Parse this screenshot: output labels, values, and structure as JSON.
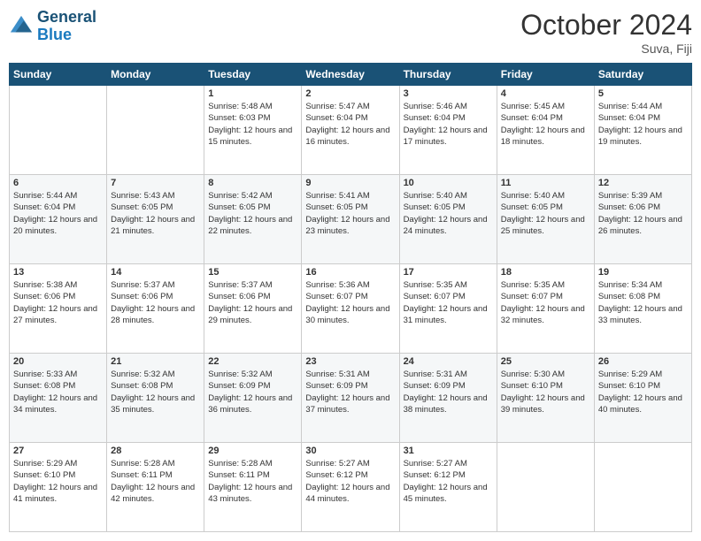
{
  "header": {
    "logo_line1": "General",
    "logo_line2": "Blue",
    "month_title": "October 2024",
    "location": "Suva, Fiji"
  },
  "days_of_week": [
    "Sunday",
    "Monday",
    "Tuesday",
    "Wednesday",
    "Thursday",
    "Friday",
    "Saturday"
  ],
  "weeks": [
    [
      {
        "day": "",
        "sunrise": "",
        "sunset": "",
        "daylight": ""
      },
      {
        "day": "",
        "sunrise": "",
        "sunset": "",
        "daylight": ""
      },
      {
        "day": "1",
        "sunrise": "Sunrise: 5:48 AM",
        "sunset": "Sunset: 6:03 PM",
        "daylight": "Daylight: 12 hours and 15 minutes."
      },
      {
        "day": "2",
        "sunrise": "Sunrise: 5:47 AM",
        "sunset": "Sunset: 6:04 PM",
        "daylight": "Daylight: 12 hours and 16 minutes."
      },
      {
        "day": "3",
        "sunrise": "Sunrise: 5:46 AM",
        "sunset": "Sunset: 6:04 PM",
        "daylight": "Daylight: 12 hours and 17 minutes."
      },
      {
        "day": "4",
        "sunrise": "Sunrise: 5:45 AM",
        "sunset": "Sunset: 6:04 PM",
        "daylight": "Daylight: 12 hours and 18 minutes."
      },
      {
        "day": "5",
        "sunrise": "Sunrise: 5:44 AM",
        "sunset": "Sunset: 6:04 PM",
        "daylight": "Daylight: 12 hours and 19 minutes."
      }
    ],
    [
      {
        "day": "6",
        "sunrise": "Sunrise: 5:44 AM",
        "sunset": "Sunset: 6:04 PM",
        "daylight": "Daylight: 12 hours and 20 minutes."
      },
      {
        "day": "7",
        "sunrise": "Sunrise: 5:43 AM",
        "sunset": "Sunset: 6:05 PM",
        "daylight": "Daylight: 12 hours and 21 minutes."
      },
      {
        "day": "8",
        "sunrise": "Sunrise: 5:42 AM",
        "sunset": "Sunset: 6:05 PM",
        "daylight": "Daylight: 12 hours and 22 minutes."
      },
      {
        "day": "9",
        "sunrise": "Sunrise: 5:41 AM",
        "sunset": "Sunset: 6:05 PM",
        "daylight": "Daylight: 12 hours and 23 minutes."
      },
      {
        "day": "10",
        "sunrise": "Sunrise: 5:40 AM",
        "sunset": "Sunset: 6:05 PM",
        "daylight": "Daylight: 12 hours and 24 minutes."
      },
      {
        "day": "11",
        "sunrise": "Sunrise: 5:40 AM",
        "sunset": "Sunset: 6:05 PM",
        "daylight": "Daylight: 12 hours and 25 minutes."
      },
      {
        "day": "12",
        "sunrise": "Sunrise: 5:39 AM",
        "sunset": "Sunset: 6:06 PM",
        "daylight": "Daylight: 12 hours and 26 minutes."
      }
    ],
    [
      {
        "day": "13",
        "sunrise": "Sunrise: 5:38 AM",
        "sunset": "Sunset: 6:06 PM",
        "daylight": "Daylight: 12 hours and 27 minutes."
      },
      {
        "day": "14",
        "sunrise": "Sunrise: 5:37 AM",
        "sunset": "Sunset: 6:06 PM",
        "daylight": "Daylight: 12 hours and 28 minutes."
      },
      {
        "day": "15",
        "sunrise": "Sunrise: 5:37 AM",
        "sunset": "Sunset: 6:06 PM",
        "daylight": "Daylight: 12 hours and 29 minutes."
      },
      {
        "day": "16",
        "sunrise": "Sunrise: 5:36 AM",
        "sunset": "Sunset: 6:07 PM",
        "daylight": "Daylight: 12 hours and 30 minutes."
      },
      {
        "day": "17",
        "sunrise": "Sunrise: 5:35 AM",
        "sunset": "Sunset: 6:07 PM",
        "daylight": "Daylight: 12 hours and 31 minutes."
      },
      {
        "day": "18",
        "sunrise": "Sunrise: 5:35 AM",
        "sunset": "Sunset: 6:07 PM",
        "daylight": "Daylight: 12 hours and 32 minutes."
      },
      {
        "day": "19",
        "sunrise": "Sunrise: 5:34 AM",
        "sunset": "Sunset: 6:08 PM",
        "daylight": "Daylight: 12 hours and 33 minutes."
      }
    ],
    [
      {
        "day": "20",
        "sunrise": "Sunrise: 5:33 AM",
        "sunset": "Sunset: 6:08 PM",
        "daylight": "Daylight: 12 hours and 34 minutes."
      },
      {
        "day": "21",
        "sunrise": "Sunrise: 5:32 AM",
        "sunset": "Sunset: 6:08 PM",
        "daylight": "Daylight: 12 hours and 35 minutes."
      },
      {
        "day": "22",
        "sunrise": "Sunrise: 5:32 AM",
        "sunset": "Sunset: 6:09 PM",
        "daylight": "Daylight: 12 hours and 36 minutes."
      },
      {
        "day": "23",
        "sunrise": "Sunrise: 5:31 AM",
        "sunset": "Sunset: 6:09 PM",
        "daylight": "Daylight: 12 hours and 37 minutes."
      },
      {
        "day": "24",
        "sunrise": "Sunrise: 5:31 AM",
        "sunset": "Sunset: 6:09 PM",
        "daylight": "Daylight: 12 hours and 38 minutes."
      },
      {
        "day": "25",
        "sunrise": "Sunrise: 5:30 AM",
        "sunset": "Sunset: 6:10 PM",
        "daylight": "Daylight: 12 hours and 39 minutes."
      },
      {
        "day": "26",
        "sunrise": "Sunrise: 5:29 AM",
        "sunset": "Sunset: 6:10 PM",
        "daylight": "Daylight: 12 hours and 40 minutes."
      }
    ],
    [
      {
        "day": "27",
        "sunrise": "Sunrise: 5:29 AM",
        "sunset": "Sunset: 6:10 PM",
        "daylight": "Daylight: 12 hours and 41 minutes."
      },
      {
        "day": "28",
        "sunrise": "Sunrise: 5:28 AM",
        "sunset": "Sunset: 6:11 PM",
        "daylight": "Daylight: 12 hours and 42 minutes."
      },
      {
        "day": "29",
        "sunrise": "Sunrise: 5:28 AM",
        "sunset": "Sunset: 6:11 PM",
        "daylight": "Daylight: 12 hours and 43 minutes."
      },
      {
        "day": "30",
        "sunrise": "Sunrise: 5:27 AM",
        "sunset": "Sunset: 6:12 PM",
        "daylight": "Daylight: 12 hours and 44 minutes."
      },
      {
        "day": "31",
        "sunrise": "Sunrise: 5:27 AM",
        "sunset": "Sunset: 6:12 PM",
        "daylight": "Daylight: 12 hours and 45 minutes."
      },
      {
        "day": "",
        "sunrise": "",
        "sunset": "",
        "daylight": ""
      },
      {
        "day": "",
        "sunrise": "",
        "sunset": "",
        "daylight": ""
      }
    ]
  ]
}
